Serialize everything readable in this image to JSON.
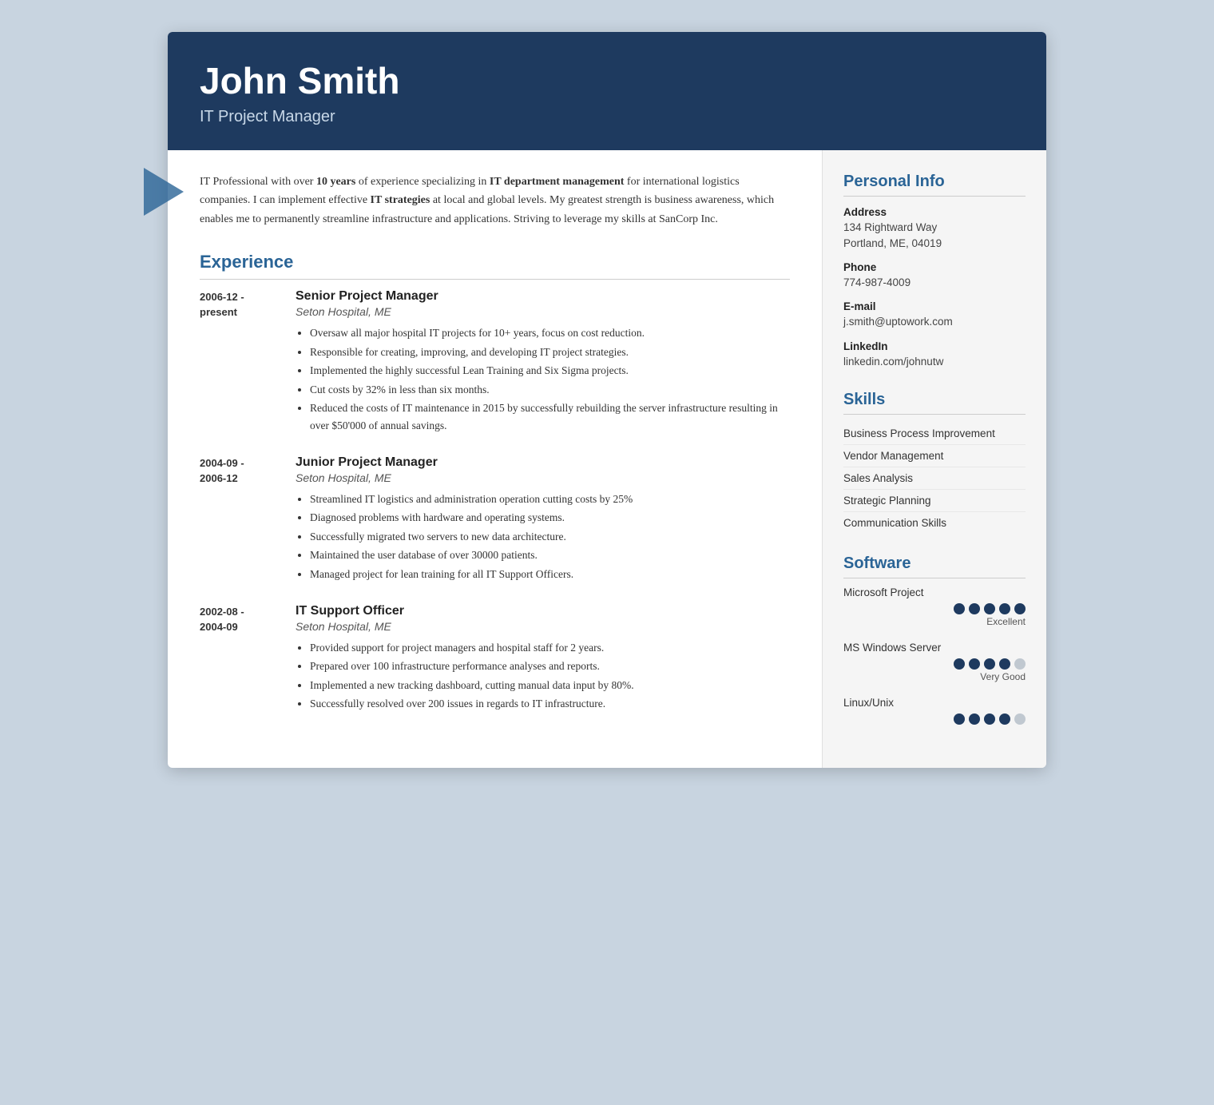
{
  "header": {
    "name": "John Smith",
    "title": "IT Project Manager"
  },
  "summary": {
    "text_parts": [
      {
        "text": "IT Professional with over ",
        "bold": false
      },
      {
        "text": "10 years",
        "bold": true
      },
      {
        "text": " of experience specializing in ",
        "bold": false
      },
      {
        "text": "IT department management",
        "bold": true
      },
      {
        "text": " for international logistics companies. I can implement effective ",
        "bold": false
      },
      {
        "text": "IT strategies",
        "bold": true
      },
      {
        "text": " at local and global levels. My greatest strength is business awareness, which enables me to permanently streamline infrastructure and applications. Striving to leverage my skills at SanCorp Inc.",
        "bold": false
      }
    ]
  },
  "experience": {
    "section_title": "Experience",
    "entries": [
      {
        "date": "2006-12 -\npresent",
        "role": "Senior Project Manager",
        "company": "Seton Hospital, ME",
        "bullets": [
          "Oversaw all major hospital IT projects for 10+ years, focus on cost reduction.",
          "Responsible for creating, improving, and developing IT project strategies.",
          "Implemented the highly successful Lean Training and Six Sigma projects.",
          "Cut costs by 32% in less than six months.",
          "Reduced the costs of IT maintenance in 2015 by successfully rebuilding the server infrastructure resulting in over $50'000 of annual savings."
        ]
      },
      {
        "date": "2004-09 -\n2006-12",
        "role": "Junior Project Manager",
        "company": "Seton Hospital, ME",
        "bullets": [
          "Streamlined IT logistics and administration operation cutting costs by 25%",
          "Diagnosed problems with hardware and operating systems.",
          "Successfully migrated two servers to new data architecture.",
          "Maintained the user database of over 30000 patients.",
          "Managed project for lean training for all IT Support Officers."
        ]
      },
      {
        "date": "2002-08 -\n2004-09",
        "role": "IT Support Officer",
        "company": "Seton Hospital, ME",
        "bullets": [
          "Provided support for project managers and hospital staff for 2 years.",
          "Prepared over 100 infrastructure performance analyses and reports.",
          "Implemented a new tracking dashboard, cutting manual data input by 80%.",
          "Successfully resolved over 200 issues in regards to IT infrastructure."
        ]
      }
    ]
  },
  "personal_info": {
    "section_title": "Personal Info",
    "fields": [
      {
        "label": "Address",
        "value": "134 Rightward Way\nPortland, ME, 04019"
      },
      {
        "label": "Phone",
        "value": "774-987-4009"
      },
      {
        "label": "E-mail",
        "value": "j.smith@uptowork.com"
      },
      {
        "label": "LinkedIn",
        "value": "linkedin.com/johnutw"
      }
    ]
  },
  "skills": {
    "section_title": "Skills",
    "items": [
      "Business Process Improvement",
      "Vendor Management",
      "Sales Analysis",
      "Strategic Planning",
      "Communication Skills"
    ]
  },
  "software": {
    "section_title": "Software",
    "items": [
      {
        "name": "Microsoft Project",
        "dots": 5,
        "filled": 5,
        "level": "Excellent"
      },
      {
        "name": "MS Windows Server",
        "dots": 5,
        "filled": 4,
        "level": "Very Good"
      },
      {
        "name": "Linux/Unix",
        "dots": 5,
        "filled": 4,
        "level": ""
      }
    ]
  },
  "colors": {
    "header_bg": "#1e3a5f",
    "accent": "#2a6496",
    "dot_filled": "#1e3a5f",
    "dot_empty": "#c0c8d0"
  }
}
